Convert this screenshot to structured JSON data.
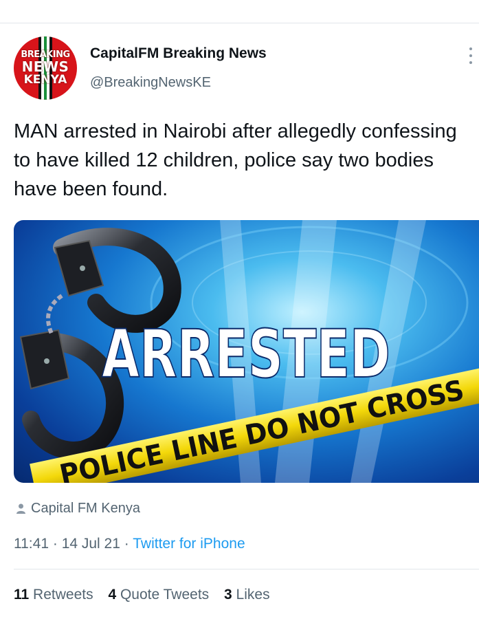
{
  "account": {
    "avatar_lines": [
      "BREAKING",
      "NEWS",
      "KENYA"
    ],
    "name": "CapitalFM Breaking News",
    "handle": "@BreakingNewsKE"
  },
  "tweet": {
    "text": "MAN arrested in Nairobi after allegedly confessing to have killed 12 children, police say two bodies have been found."
  },
  "media": {
    "headline": "ARRESTED",
    "tape_text": "POLICE LINE DO NOT CROSS"
  },
  "attribution": {
    "icon": "person-icon",
    "label": "Capital FM Kenya"
  },
  "meta": {
    "time": "11:41",
    "separator": "·",
    "date": "14 Jul 21",
    "source": "Twitter for iPhone"
  },
  "stats": {
    "retweets_count": "11",
    "retweets_label": "Retweets",
    "quotes_count": "4",
    "quotes_label": "Quote Tweets",
    "likes_count": "3",
    "likes_label": "Likes"
  },
  "colors": {
    "link": "#1d9bf0",
    "secondary_text": "#536471",
    "avatar_red": "#d7141a"
  }
}
